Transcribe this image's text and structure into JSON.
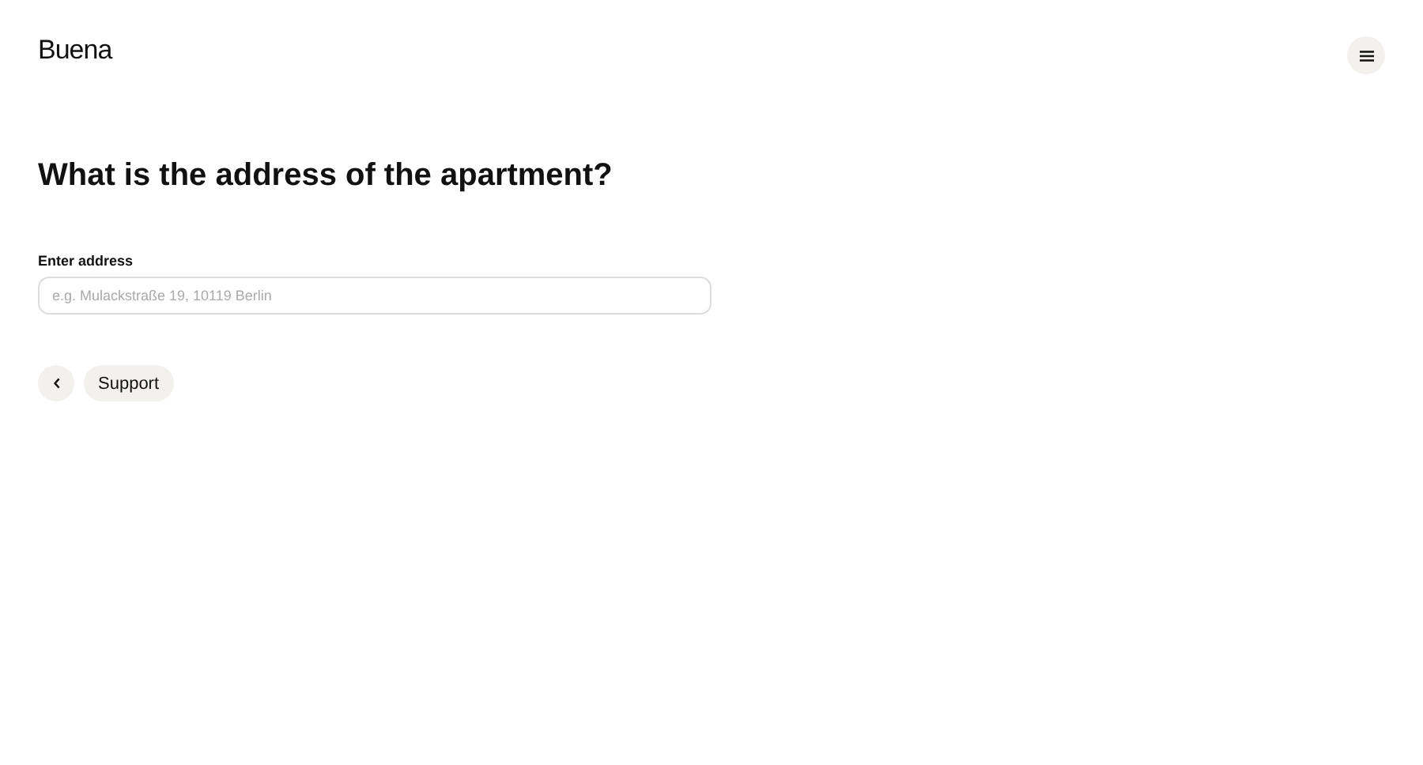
{
  "header": {
    "logo": "Buena"
  },
  "question": "What is the address of the apartment?",
  "address_field": {
    "label": "Enter address",
    "placeholder": "e.g. Mulackstraße 19, 10119 Berlin"
  },
  "buttons": [
    {
      "kind": "back"
    },
    {
      "kind": "text",
      "label": "Support"
    }
  ]
}
